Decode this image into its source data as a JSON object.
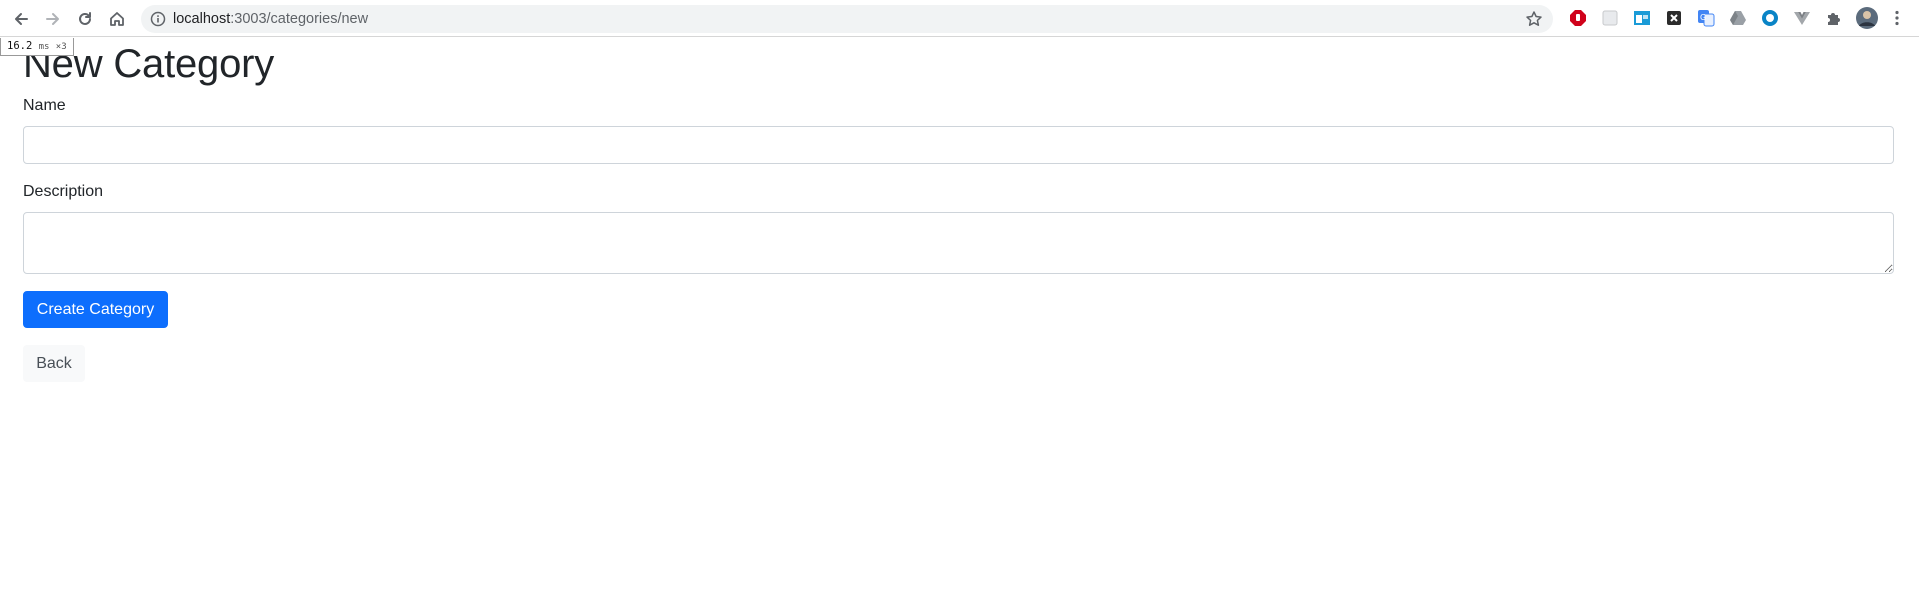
{
  "browser": {
    "url_host": "localhost",
    "url_rest": ":3003/categories/new",
    "extensions": [
      "adblock-icon",
      "blank-extension-icon",
      "window-extension-icon",
      "x-extension-icon",
      "translate-icon",
      "drive-icon",
      "circle-extension-icon",
      "vue-devtools-icon",
      "puzzle-icon",
      "profile-avatar"
    ],
    "colors": {
      "omnibox": "#f1f3f4"
    }
  },
  "timing": {
    "value": "16.2",
    "unit": "ms",
    "count": "×3"
  },
  "page": {
    "title": "New Category",
    "fields": {
      "name_label": "Name",
      "name_value": "",
      "description_label": "Description",
      "description_value": ""
    },
    "submit_label": "Create Category",
    "back_label": "Back",
    "colors": {
      "primary": "#0d6efd",
      "back_bg": "#f8f9fa"
    }
  }
}
